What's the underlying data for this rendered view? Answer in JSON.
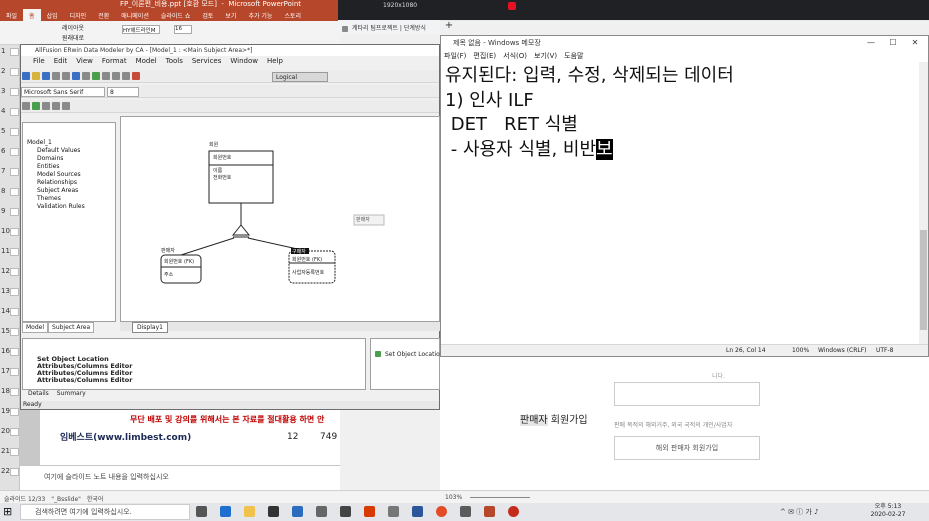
{
  "powerpoint": {
    "title": "Microsoft PowerPoint",
    "file_name": "FP_이론편_비용.ppt [호환 모드]",
    "ribbon_tabs": [
      "파일",
      "홈",
      "삽입",
      "디자인",
      "전환",
      "애니메이션",
      "슬라이드 쇼",
      "검토",
      "보기",
      "추가 기능",
      "스토리"
    ],
    "active_tab": "홈",
    "ribbon_items": [
      "레이아웃",
      "원래대로",
      "HY헤드라인M",
      "16"
    ],
    "slide_numbers": [
      "1",
      "2",
      "3",
      "4",
      "5",
      "6",
      "7",
      "8",
      "9",
      "10",
      "11",
      "12",
      "13",
      "14",
      "15",
      "16",
      "17",
      "18",
      "19",
      "20",
      "21",
      "22"
    ],
    "banner_warning": "무단 배포 및 강의를 위해서는 본 자료를 절대활용 하면 안",
    "banner_site": "임베스트(www.limbest.com)",
    "banner_page": "12",
    "banner_num": "749",
    "notes_placeholder": "여기에 슬라이드 노트 내용을 입력하십시오",
    "status_slide": "슬라이드 12/33",
    "status_theme": "\"_Bsslide\"",
    "status_lang": "한국어",
    "zoom": "103%"
  },
  "browser": {
    "tab_title": "계타리 팀프로젝트 | 단계방식",
    "new_tab": "+",
    "top_text": "1920x1080",
    "seller_join_prefix": "판매자",
    "seller_join_suffix": " 회원가입",
    "seller_sub": "판매 목적의 해외거주, 외국 국적의 개인/사업자",
    "seller_button": "해외 판매자 회원가입",
    "note": "니다."
  },
  "erwin": {
    "title": "AllFusion ERwin Data Modeler by CA - [Model_1 : <Main Subject Area>*]",
    "menu": [
      "File",
      "Edit",
      "View",
      "Format",
      "Model",
      "Tools",
      "Services",
      "Window",
      "Help"
    ],
    "font": "Microsoft Sans Serif",
    "font_size": "8",
    "view_mode": "Logical",
    "tree": [
      {
        "label": "Model_1",
        "level": 0
      },
      {
        "label": "Default Values",
        "level": 1
      },
      {
        "label": "Domains",
        "level": 1
      },
      {
        "label": "Entities",
        "level": 1
      },
      {
        "label": "Model Sources",
        "level": 1
      },
      {
        "label": "Relationships",
        "level": 1
      },
      {
        "label": "Subject Areas",
        "level": 1
      },
      {
        "label": "Themes",
        "level": 1
      },
      {
        "label": "Validation Rules",
        "level": 1
      }
    ],
    "tree_tabs": [
      "Model",
      "Subject Area"
    ],
    "diagram_tab": "Display1",
    "entities": {
      "member": {
        "name": "회원",
        "pk": "회원번호",
        "attrs": [
          "이름",
          "전화번호"
        ]
      },
      "seller": {
        "name": "판매자",
        "attrs": [
          "회원번호 (FK)",
          "주소"
        ]
      },
      "buyer": {
        "name": "구매자",
        "attrs": [
          "회원번호 (FK)",
          "사업자등록번호"
        ]
      }
    },
    "floating_label": "판매자",
    "actions": [
      "Set Object Location",
      "Attributes/Columns Editor",
      "Attributes/Columns Editor",
      "Attributes/Columns Editor"
    ],
    "side_action": "Set Object Location",
    "bottom_tabs": [
      "Details",
      "Summary"
    ],
    "status": "Ready"
  },
  "notepad": {
    "title": "제목 없음 - Windows 메모장",
    "menu": [
      "파일(F)",
      "편집(E)",
      "서식(O)",
      "보기(V)",
      "도움말"
    ],
    "lines": [
      "유지된다: 입력, 수정, 삭제되는 데이터",
      "",
      "",
      "1) 인사 ILF",
      " DET   RET 식별",
      "",
      " - 사용자 식별, 비반"
    ],
    "selected_char": "보",
    "status_pos": "Ln 26, Col 14",
    "status_zoom": "100%",
    "status_eol": "Windows (CRLF)",
    "status_enc": "UTF-8",
    "controls": [
      "—",
      "☐",
      "✕"
    ]
  },
  "taskbar": {
    "search_placeholder": "검색하려면 여기에 입력하십시오.",
    "tray": "^  ✉  ⓘ  가  ♪",
    "time": "오후 5:13",
    "date": "2020-02-27"
  },
  "colors": {
    "ppt_accent": "#b7472a",
    "selection": "#000000"
  }
}
